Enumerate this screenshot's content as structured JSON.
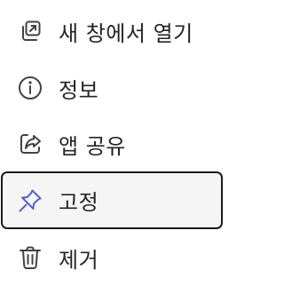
{
  "menu": {
    "items": [
      {
        "label": "새 창에서 열기",
        "icon": "open-in-new-window-icon"
      },
      {
        "label": "정보",
        "icon": "info-icon"
      },
      {
        "label": "앱 공유",
        "icon": "share-icon"
      },
      {
        "label": "고정",
        "icon": "pin-icon",
        "focused": true
      },
      {
        "label": "제거",
        "icon": "trash-icon"
      }
    ],
    "colors": {
      "text": "#242424",
      "icon": "#424242",
      "accent": "#5b5fc7",
      "focus_border": "#1b1b1b",
      "focus_bg": "#f5f5f5"
    }
  }
}
